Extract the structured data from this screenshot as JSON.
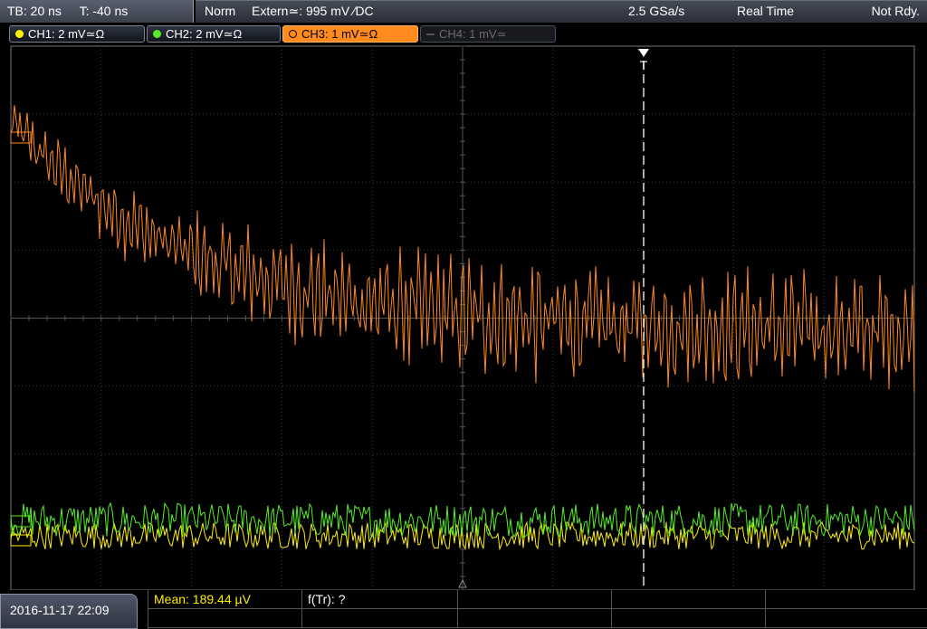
{
  "status_bar": {
    "timebase": "TB: 20 ns",
    "trigger_time": "T: -40 ns",
    "trigger_mode": "Norm",
    "trigger_source": "Extern≃: 995 mV ∕DC",
    "sample_rate": "2.5 GSa/s",
    "acquisition_mode": "Real Time",
    "run_state": "Not Rdy."
  },
  "channels": [
    {
      "id": "ch1",
      "label": "CH1: 2 mV≃Ω",
      "color": "#ffef00",
      "active": true
    },
    {
      "id": "ch2",
      "label": "CH2: 2 mV≃Ω",
      "color": "#55ee22",
      "active": true
    },
    {
      "id": "ch3",
      "label": "CH3: 1 mV≃Ω",
      "color": "#ff8a1e",
      "active": true,
      "selected": true
    },
    {
      "id": "ch4",
      "label": "CH4: 1 mV≃",
      "color": "#555555",
      "active": false
    }
  ],
  "trigger_marker": "T",
  "measurements": {
    "mean": "Mean: 189.44 µV",
    "ftr": "f(Tr): ?"
  },
  "datetime": "2016-11-17 22:09",
  "waveforms": {
    "ch3": {
      "description_free": true,
      "start_level_div": 2.9,
      "decay_level_div": -0.2,
      "noise_amp_div": 0.9
    },
    "ch2": {
      "level_div": -2.97,
      "noise_amp_div": 0.25
    },
    "ch1": {
      "level_div": -3.2,
      "noise_amp_div": 0.2
    }
  },
  "colors": {
    "grid": "#3a3a3a",
    "grid_axis": "#555555",
    "trigger_line": "#ffffff",
    "ch3": "#ff8a1e",
    "ch2": "#55ee22",
    "ch1": "#ffef00"
  }
}
